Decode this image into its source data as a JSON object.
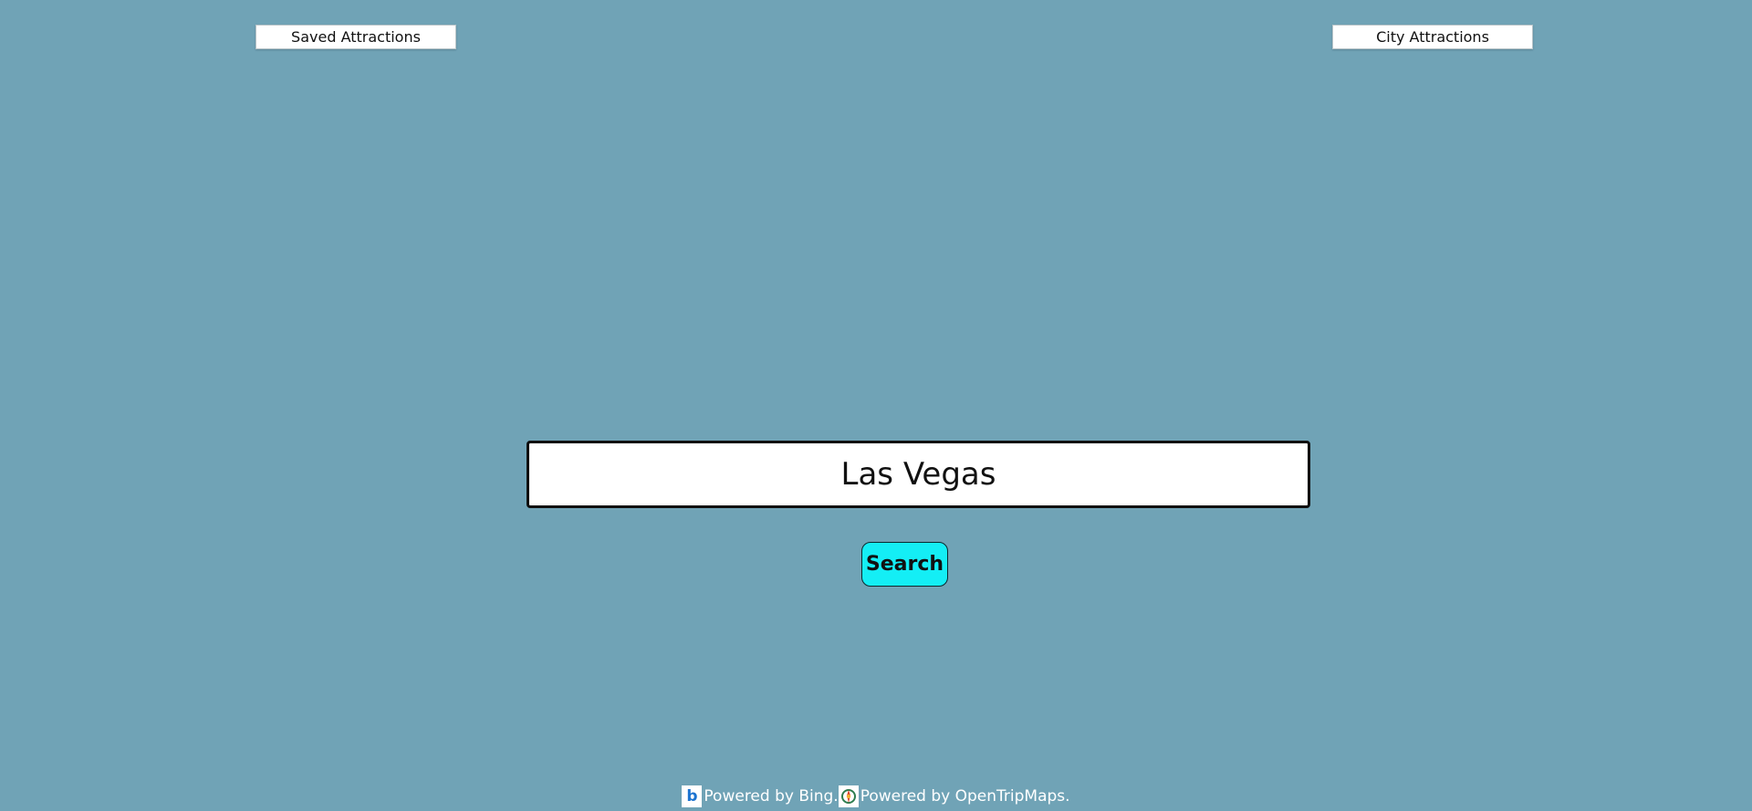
{
  "header": {
    "saved_label": "Saved Attractions",
    "city_label": "City Attractions"
  },
  "search": {
    "value": "Las Vegas",
    "button_label": "Search"
  },
  "footer": {
    "bing_logo_letter": "b",
    "bing_text": "Powered by Bing.",
    "otm_text": "Powered by OpenTripMaps."
  },
  "colors": {
    "background": "#70a3b6",
    "search_button": "#14eef5"
  },
  "icons": {
    "bing": "bing-logo-icon",
    "opentripmap": "opentripmap-logo-icon"
  }
}
